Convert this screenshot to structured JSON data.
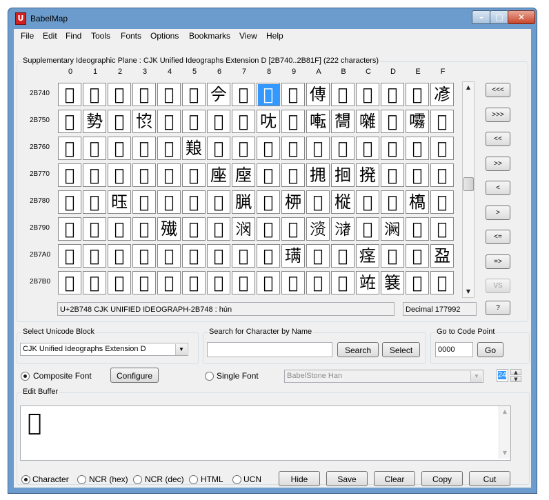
{
  "window": {
    "title": "BabelMap"
  },
  "menu": [
    "File",
    "Edit",
    "Find",
    "Tools",
    "Fonts",
    "Options",
    "Bookmarks",
    "View",
    "Help"
  ],
  "grid": {
    "title": "Supplementary Ideographic Plane : CJK Unified Ideographs Extension D [2B740..2B81F] (222 characters)",
    "columns": [
      "0",
      "1",
      "2",
      "3",
      "4",
      "5",
      "6",
      "7",
      "8",
      "9",
      "A",
      "B",
      "C",
      "D",
      "E",
      "F"
    ],
    "rows": [
      {
        "label": "2B740",
        "chars": [
          "𫝀",
          "𫝁",
          "𫝂",
          "𫝃",
          "𫝄",
          "𫝅",
          "𫝆",
          "𫝇",
          "𫝈",
          "𫝉",
          "𫝊",
          "𫝋",
          "𫝌",
          "𫝍",
          "𫝎",
          "𫝏"
        ]
      },
      {
        "label": "2B750",
        "chars": [
          "𫝐",
          "𫝑",
          "𫝒",
          "𫝓",
          "𫝔",
          "𫝕",
          "𫝖",
          "𫝗",
          "𫝘",
          "𫝙",
          "𫝚",
          "𫝛",
          "𫝜",
          "𫝝",
          "𫝞",
          "𫝟"
        ]
      },
      {
        "label": "2B760",
        "chars": [
          "𫝠",
          "𫝡",
          "𫝢",
          "𫝣",
          "𫝤",
          "𫝥",
          "𫝦",
          "𫝧",
          "𫝨",
          "𫝩",
          "𫝪",
          "𫝫",
          "𫝬",
          "𫝭",
          "𫝮",
          "𫝯"
        ]
      },
      {
        "label": "2B770",
        "chars": [
          "𫝰",
          "𫝱",
          "𫝲",
          "𫝳",
          "𫝴",
          "𫝵",
          "𫝶",
          "𫝷",
          "𫝸",
          "𫝹",
          "𫝺",
          "𫝻",
          "𫝼",
          "𫝽",
          "𫝾",
          "𫝿"
        ]
      },
      {
        "label": "2B780",
        "chars": [
          "𫞀",
          "𫞁",
          "𫞂",
          "𫞃",
          "𫞄",
          "𫞅",
          "𫞆",
          "𫞇",
          "𫞈",
          "𫞉",
          "𫞊",
          "𫞋",
          "𫞌",
          "𫞍",
          "𫞎",
          "𫞏"
        ]
      },
      {
        "label": "2B790",
        "chars": [
          "𫞐",
          "𫞑",
          "𫞒",
          "𫞓",
          "𫞔",
          "𫞕",
          "𫞖",
          "𫞗",
          "𫞘",
          "𫞙",
          "𫞚",
          "𫞛",
          "𫞜",
          "𫞝",
          "𫞞",
          "𫞟"
        ]
      },
      {
        "label": "2B7A0",
        "chars": [
          "𫞠",
          "𫞡",
          "𫞢",
          "𫞣",
          "𫞤",
          "𫞥",
          "𫞦",
          "𫞧",
          "𫞨",
          "𫞩",
          "𫞪",
          "𫞫",
          "𫞬",
          "𫞭",
          "𫞮",
          "𫞯"
        ]
      },
      {
        "label": "2B7B0",
        "chars": [
          "𫞰",
          "𫞱",
          "𫞲",
          "𫞳",
          "𫞴",
          "𫞵",
          "𫞶",
          "𫞷",
          "𫞸",
          "𫞹",
          "𫞺",
          "𫞻",
          "𫞼",
          "𫞽",
          "𫞾",
          "𫞿"
        ]
      }
    ],
    "selected": {
      "row": 0,
      "col": 8
    },
    "status_name": "U+2B748 CJK UNIFIED IDEOGRAPH-2B748 : hún",
    "status_decimal": "Decimal 177992",
    "nav_buttons": [
      "<<<",
      ">>>",
      "<<",
      ">>",
      "<",
      ">",
      "<=",
      "=>",
      "VS",
      "?"
    ],
    "scroll_up_icon": "▲",
    "scroll_down_icon": "▼"
  },
  "unicode_block": {
    "label": "Select Unicode Block",
    "value": "CJK Unified Ideographs Extension D"
  },
  "search": {
    "label": "Search for Character by Name",
    "value": "",
    "search_button": "Search",
    "select_button": "Select"
  },
  "goto": {
    "label": "Go to Code Point",
    "value": "0000",
    "go_button": "Go"
  },
  "font": {
    "composite_label": "Composite Font",
    "configure_button": "Configure",
    "single_label": "Single Font",
    "single_value": "BabelStone Han",
    "size": "24"
  },
  "edit_buffer": {
    "label": "Edit Buffer",
    "content": "𫝈"
  },
  "output_formats": [
    "Character",
    "NCR (hex)",
    "NCR (dec)",
    "HTML",
    "UCN"
  ],
  "actions": [
    "Hide",
    "Save",
    "Clear",
    "Copy",
    "Cut"
  ],
  "icons": {
    "app": "app-icon",
    "minimize": "minimize-icon",
    "maximize": "maximize-icon",
    "close": "close-icon",
    "dropdown": "chevron-down-icon"
  },
  "colors": {
    "selection": "#3399ff",
    "title_bar": "#6b9ccd"
  }
}
